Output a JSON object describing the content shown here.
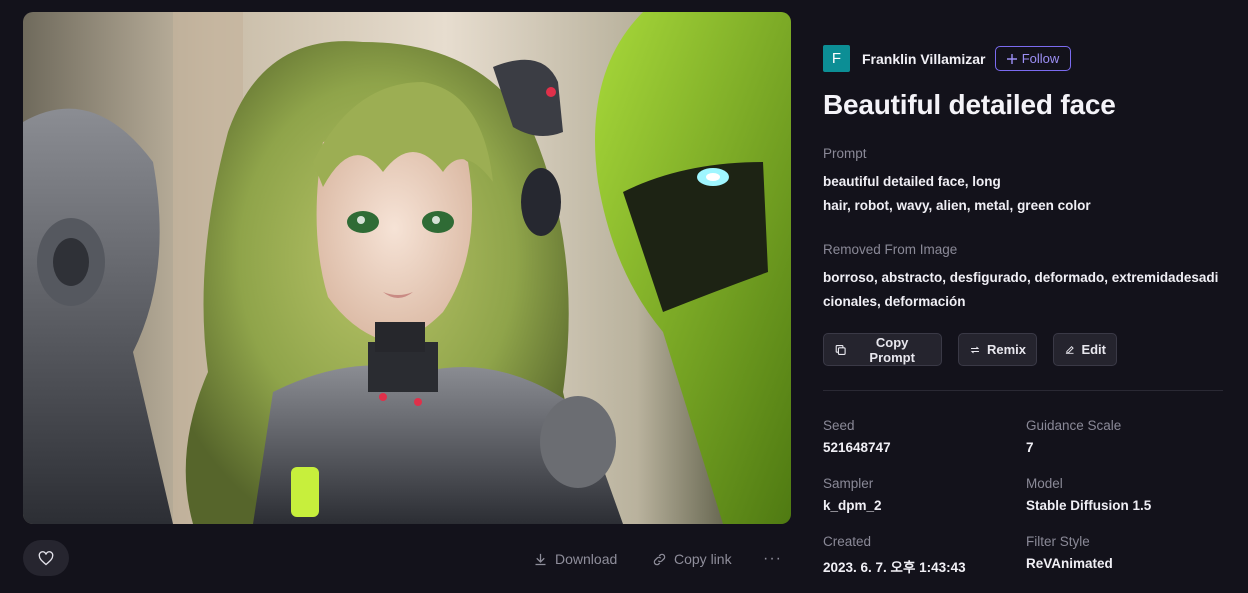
{
  "author": {
    "initial": "F",
    "name": "Franklin Villamizar",
    "follow_label": "Follow"
  },
  "title": "Beautiful detailed face",
  "prompt": {
    "label": "Prompt",
    "line1": "beautiful detailed face, long",
    "line2": "hair, robot, wavy, alien, metal, green color"
  },
  "removed": {
    "label": "Removed From Image",
    "line1": "borroso, abstracto, desfigurado, deformado, extremidadesadi",
    "line2": "cionales, deformación"
  },
  "buttons": {
    "copy_prompt": "Copy Prompt",
    "remix": "Remix",
    "edit": "Edit"
  },
  "footer": {
    "download": "Download",
    "copy_link": "Copy link",
    "more": "···"
  },
  "meta": {
    "seed_label": "Seed",
    "seed": "521648747",
    "guidance_label": "Guidance Scale",
    "guidance": "7",
    "sampler_label": "Sampler",
    "sampler": "k_dpm_2",
    "model_label": "Model",
    "model": "Stable Diffusion 1.5",
    "created_label": "Created",
    "created": "2023. 6. 7. 오후 1:43:43",
    "filter_label": "Filter Style",
    "filter": "ReVAnimated"
  },
  "colors": {
    "accent": "#7b6bf0",
    "avatar": "#0c8e95",
    "background": "#13121b"
  },
  "icons": [
    "heart-icon",
    "download-icon",
    "link-icon",
    "more-icon",
    "plus-icon",
    "copy-icon",
    "remix-icon",
    "edit-icon"
  ]
}
